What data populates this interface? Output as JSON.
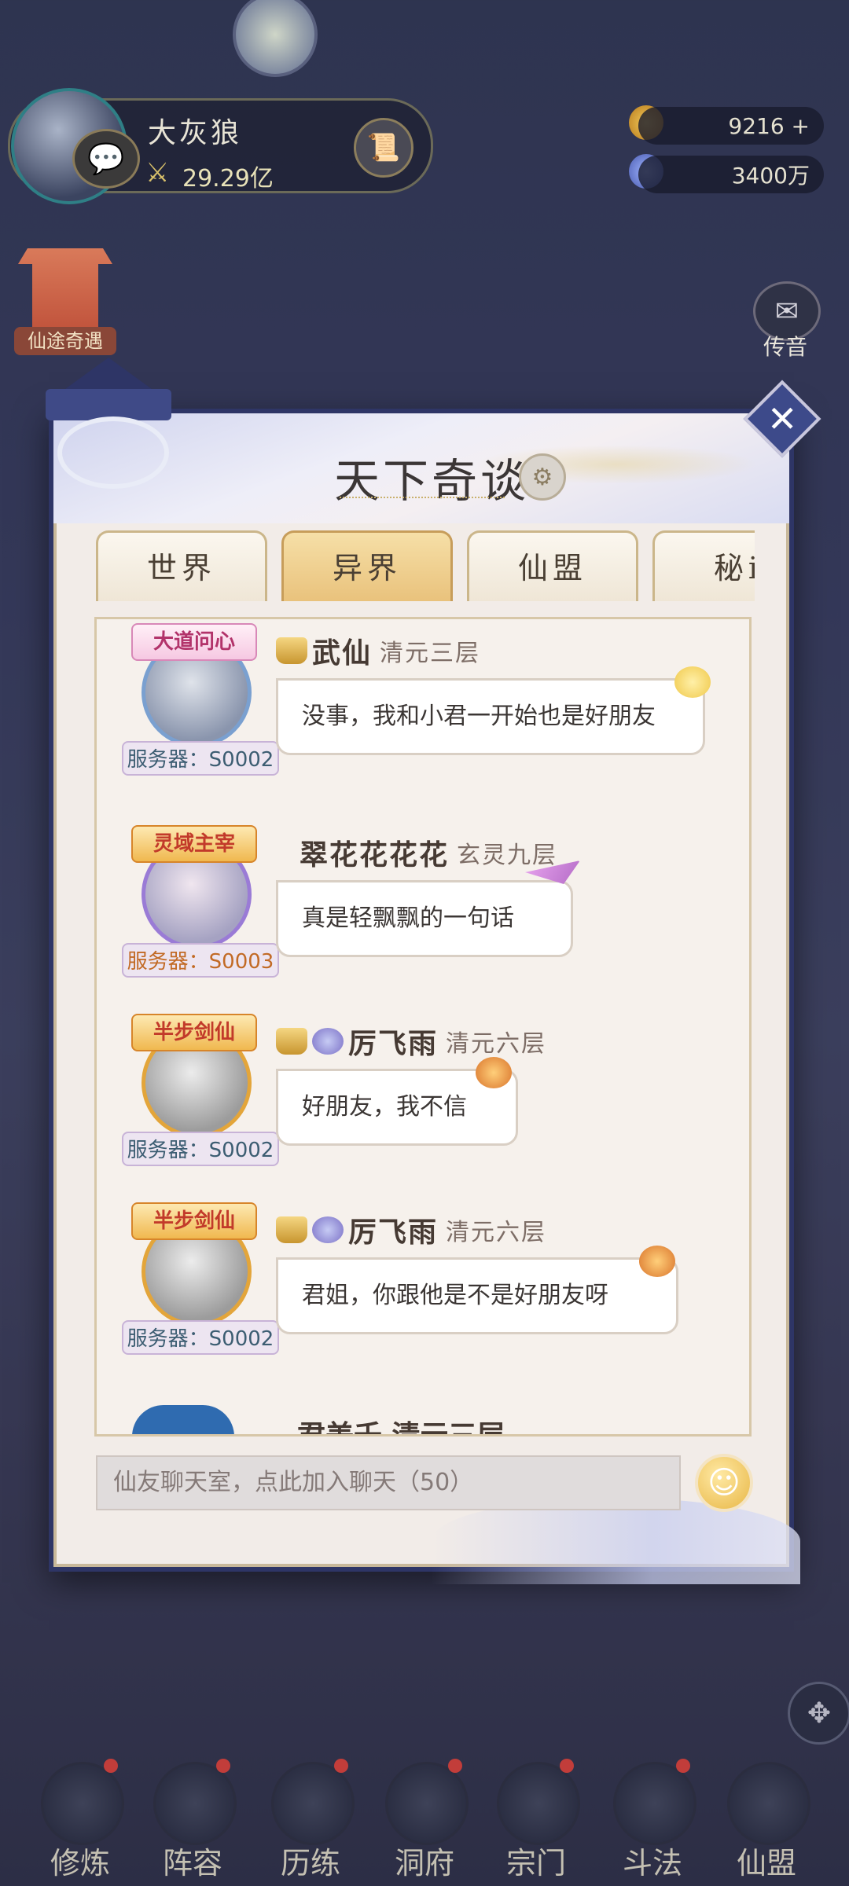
{
  "hud": {
    "player_name": "大灰狼",
    "combat_power": "29.29亿",
    "gold": "9216 +",
    "currency": "3400万",
    "event_label": "仙途奇遇",
    "mail_label": "传音"
  },
  "panel": {
    "title": "天下奇谈",
    "tabs": [
      "世界",
      "异界",
      "仙盟",
      "秘i"
    ],
    "active_tab": "异界",
    "messages": [
      {
        "badge": "大道问心",
        "name": "武仙",
        "level": "清元三层",
        "server": "服务器：S0002",
        "text": "没事，我和小君一开始也是好朋友"
      },
      {
        "badge": "灵域主宰",
        "name": "翠花花花花",
        "level": "玄灵九层",
        "server": "服务器：S0003",
        "text": "真是轻飘飘的一句话"
      },
      {
        "badge": "半步剑仙",
        "name": "厉飞雨",
        "level": "清元六层",
        "server": "服务器：S0002",
        "text": "好朋友，我不信"
      },
      {
        "badge": "半步剑仙",
        "name": "厉飞雨",
        "level": "清元六层",
        "server": "服务器：S0002",
        "text": "君姐，你跟他是不是好朋友呀"
      }
    ],
    "partial_name": "君美千 清元三层",
    "input_placeholder": "仙友聊天室，点此加入聊天（50）"
  },
  "bottom_nav": [
    "修炼",
    "阵容",
    "历练",
    "洞府",
    "宗门",
    "斗法",
    "仙盟"
  ],
  "colors": {
    "accent": "#2e3566",
    "active_tab": "#e9c27c"
  }
}
